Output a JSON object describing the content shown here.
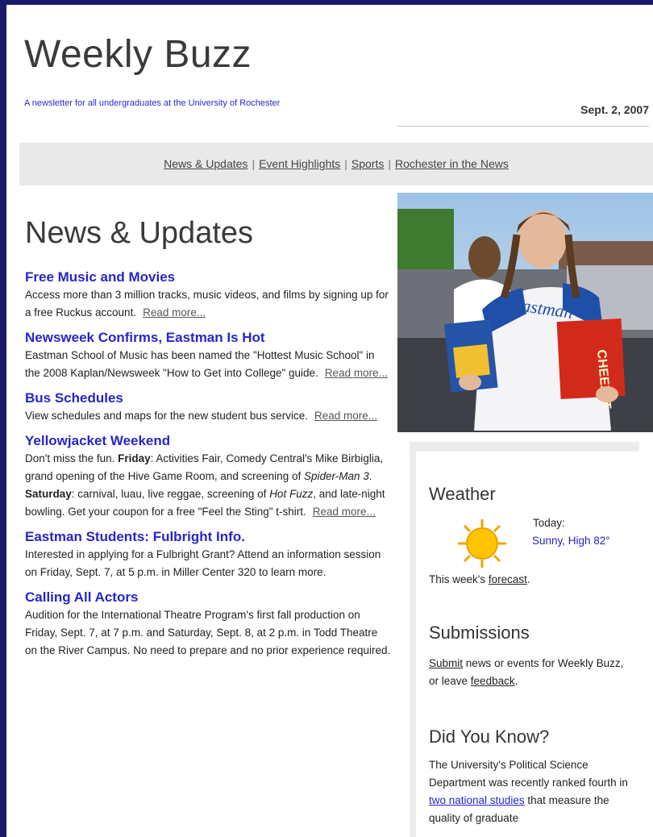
{
  "header": {
    "title": "Weekly Buzz",
    "tagline": "A newsletter for all undergraduates at the University of Rochester",
    "date": "Sept. 2, 2007"
  },
  "nav": {
    "items": [
      "News & Updates",
      "Event Highlights",
      "Sports",
      "Rochester in the News"
    ],
    "separator": "|"
  },
  "main": {
    "section_title": "News & Updates",
    "read_more": "Read more...",
    "articles": [
      {
        "title": "Free Music and Movies",
        "body": "Access more than 3 million tracks, music videos, and films by signing up for a free Ruckus account."
      },
      {
        "title": "Newsweek Confirms, Eastman Is Hot",
        "body": "Eastman School of Music has been named the \"Hottest Music School\" in the 2008 Kaplan/Newsweek \"How to Get into College\" guide."
      },
      {
        "title": "Bus Schedules",
        "body": "View schedules and maps for the new student bus service."
      },
      {
        "title": "Yellowjacket Weekend",
        "body_1": "Don't miss the fun.",
        "friday_label": "Friday",
        "body_2": ": Activities Fair, Comedy Central's Mike Birbiglia, grand opening of the Hive Game Room, and screening of",
        "movie_1": "Spider-Man 3",
        "saturday_label": "Saturday",
        "body_3": ": carnival, luau, live reggae, screening of",
        "movie_2": "Hot Fuzz",
        "body_4": ", and late-night bowling. Get your coupon for a free \"Feel the Sting\" t-shirt."
      },
      {
        "title": "Eastman Students: Fulbright Info.",
        "body": "Interested in applying for a Fulbright Grant? Attend an information session on Friday, Sept. 7, at 5 p.m. in Miller Center 320 to learn more."
      },
      {
        "title": "Calling All Actors",
        "body": "Audition for the International Theatre Program's first fall production on Friday, Sept. 7, at 7 p.m. and Saturday, Sept. 8, at 2 p.m. in Todd Theatre on the River Campus. No need to prepare and no prior experience required."
      }
    ]
  },
  "photo": {
    "shirt_text": "Eastman",
    "box_text": "CHEEZ-IT"
  },
  "sidebar": {
    "weather": {
      "heading": "Weather",
      "today_label": "Today:",
      "conditions": "Sunny, High 82°",
      "week_text_pre": "This week's",
      "forecast_link": "forecast",
      "week_text_post": "."
    },
    "submissions": {
      "heading": "Submissions",
      "submit_link": "Submit",
      "text_mid": "news or events for Weekly Buzz, or leave",
      "feedback_link": "feedback",
      "text_end": "."
    },
    "did_you_know": {
      "heading": "Did You Know?",
      "text_pre": "The University's Political Science Department was recently ranked fourth in",
      "studies_link": "two national studies",
      "text_post": "that measure the quality of graduate"
    }
  },
  "colors": {
    "frame": "#1a1a6b",
    "headline_blue": "#2626c8",
    "nav_bg": "#e9e9e9"
  }
}
